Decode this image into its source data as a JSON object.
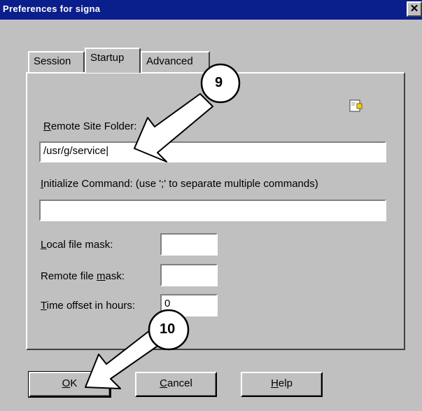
{
  "window": {
    "title": "Preferences for signa",
    "close_glyph": "✕"
  },
  "tabs": [
    {
      "label": "Session",
      "active": false
    },
    {
      "label": "Startup",
      "active": true
    },
    {
      "label": "Advanced",
      "active": false
    }
  ],
  "startup": {
    "remote_site_folder": {
      "label_key": "R",
      "label_rest": "emote Site Folder:",
      "value": "/usr/g/service"
    },
    "initialize_command": {
      "label_key": "I",
      "label_rest": "nitialize Command: (use ';' to separate multiple commands)",
      "value": ""
    },
    "local_file_mask": {
      "label_key": "L",
      "label_rest": "ocal file mask:",
      "value": ""
    },
    "remote_file_mask": {
      "label_pre": "Remote file ",
      "label_key": "m",
      "label_rest": "ask:",
      "value": ""
    },
    "time_offset": {
      "label_key": "T",
      "label_rest": "ime offset in hours:",
      "value": "0"
    }
  },
  "buttons": {
    "ok": {
      "key": "O",
      "rest": "K"
    },
    "cancel": {
      "key": "C",
      "rest": "ancel"
    },
    "help": {
      "key": "H",
      "rest": "elp"
    }
  },
  "callouts": [
    {
      "number": "9"
    },
    {
      "number": "10"
    }
  ],
  "icons": {
    "settings": "settings-icon",
    "close": "close-icon"
  },
  "colors": {
    "titlebar": "#0a1e8c",
    "face": "#c0c0c0"
  }
}
